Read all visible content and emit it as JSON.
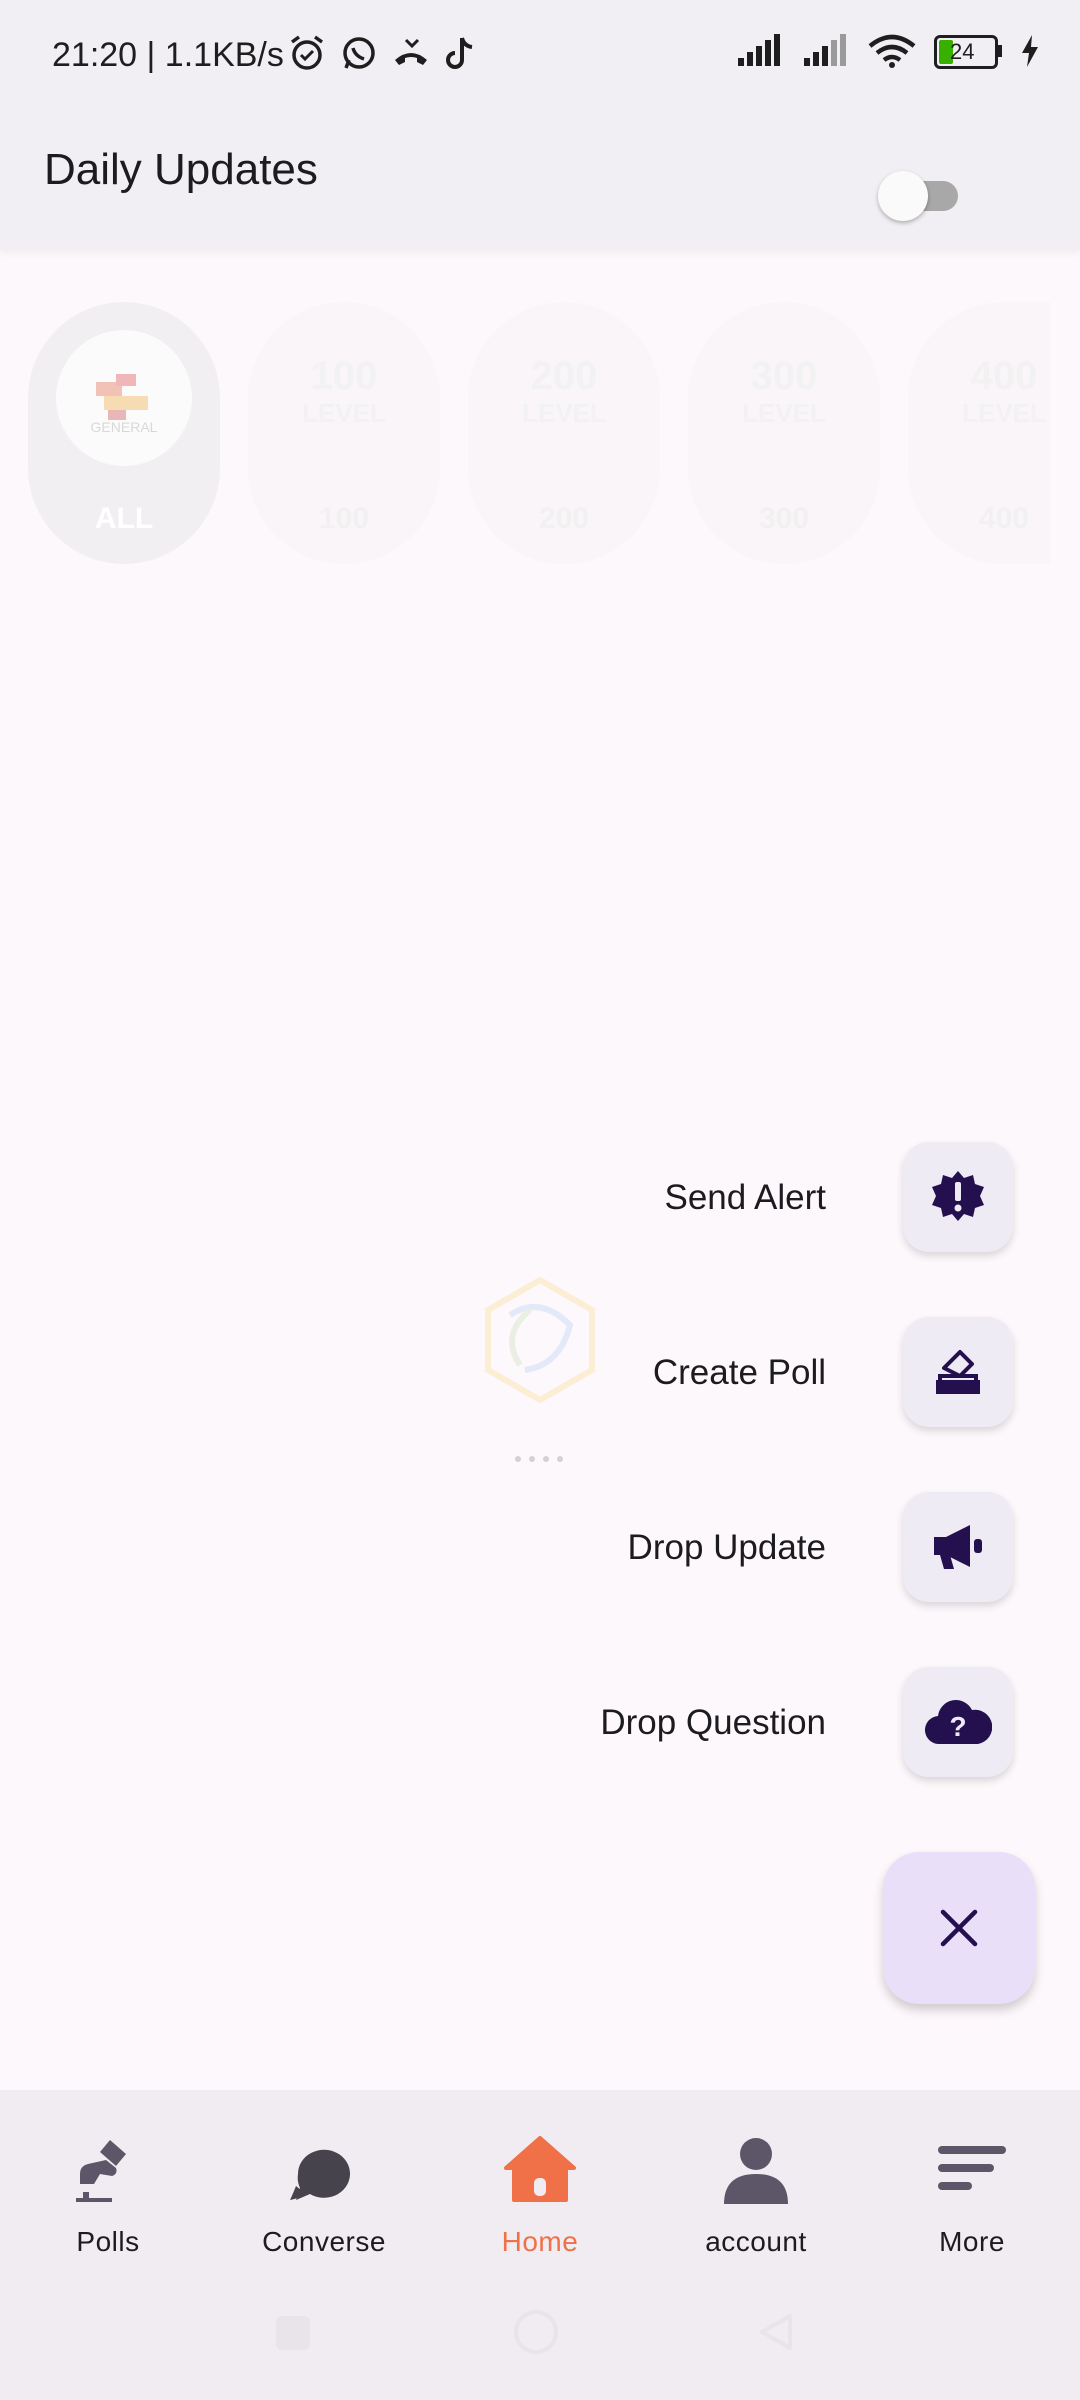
{
  "status_bar": {
    "time": "21:20 | 1.1KB/s",
    "battery": "24"
  },
  "app_bar": {
    "title": "Daily Updates",
    "toggle_on": false
  },
  "levels": [
    {
      "big": "",
      "sub": "",
      "caption": "ALL",
      "logo_text": "GENERAL",
      "active": true
    },
    {
      "big": "100",
      "sub": "LEVEL",
      "caption": "100"
    },
    {
      "big": "200",
      "sub": "LEVEL",
      "caption": "200"
    },
    {
      "big": "300",
      "sub": "LEVEL",
      "caption": "300"
    },
    {
      "big": "400",
      "sub": "LEVEL",
      "caption": "400"
    }
  ],
  "fab_menu": {
    "items": [
      {
        "label": "Send Alert",
        "icon": "alert-badge-icon"
      },
      {
        "label": "Create Poll",
        "icon": "ballot-box-icon"
      },
      {
        "label": "Drop Update",
        "icon": "megaphone-icon"
      },
      {
        "label": "Drop Question",
        "icon": "cloud-question-icon"
      }
    ],
    "close_icon": "close-icon"
  },
  "bottom_nav": {
    "items": [
      {
        "label": "Polls",
        "icon": "hand-vote-icon"
      },
      {
        "label": "Converse",
        "icon": "chat-bubbles-icon"
      },
      {
        "label": "Home",
        "icon": "home-icon",
        "active": true
      },
      {
        "label": "account",
        "icon": "person-icon"
      },
      {
        "label": "More",
        "icon": "menu-lines-icon"
      }
    ]
  },
  "colors": {
    "accent": "#f07048",
    "icon_dark": "#24104f",
    "nav_icon": "#5d5668"
  }
}
